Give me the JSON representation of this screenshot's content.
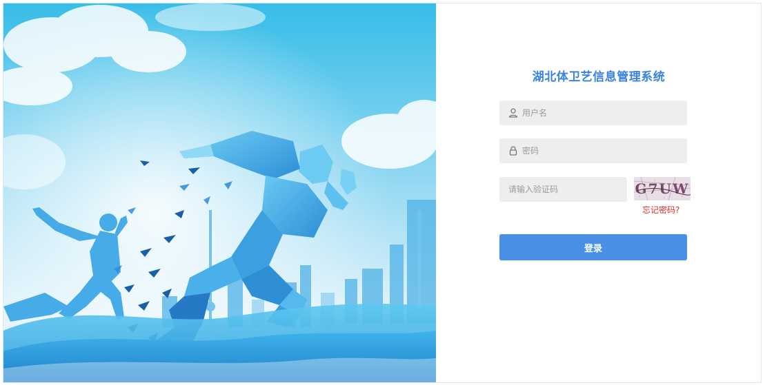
{
  "login": {
    "title": "湖北体卫艺信息管理系统",
    "username_placeholder": "用户名",
    "password_placeholder": "密码",
    "captcha_placeholder": "请输入验证码",
    "captcha_text": "G7UW",
    "forgot_label": "忘记密码?",
    "submit_label": "登录"
  },
  "colors": {
    "accent": "#3b82e0",
    "button": "#4a8fe6",
    "forgot": "#e02a2a",
    "field_bg": "#eeeeee"
  },
  "icons": {
    "username": "user-icon",
    "password": "lock-icon"
  }
}
